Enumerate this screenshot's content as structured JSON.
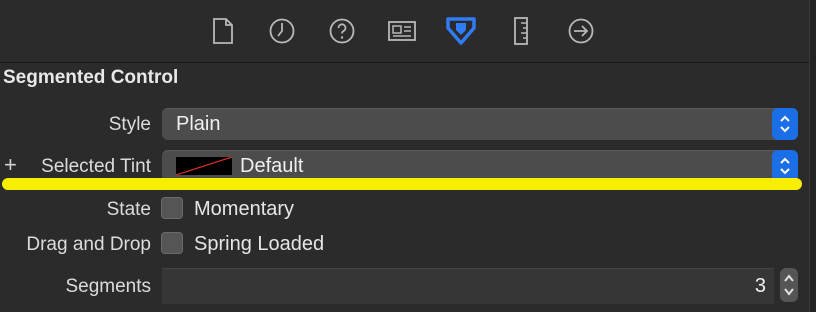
{
  "toolbar": {
    "icons": [
      {
        "name": "file-inspector-icon"
      },
      {
        "name": "history-inspector-icon"
      },
      {
        "name": "quick-help-icon"
      },
      {
        "name": "identity-inspector-icon"
      },
      {
        "name": "attributes-inspector-icon",
        "active": true
      },
      {
        "name": "size-inspector-icon"
      },
      {
        "name": "connections-inspector-icon"
      }
    ],
    "active_color": "#2f7cf6",
    "icon_color": "#b8b8b8"
  },
  "section": {
    "title": "Segmented Control"
  },
  "style": {
    "label": "Style",
    "value": "Plain"
  },
  "tint": {
    "label": "Selected Tint",
    "plus": "+",
    "value": "Default"
  },
  "state": {
    "label": "State",
    "option": "Momentary",
    "checked": false
  },
  "drag_drop": {
    "label": "Drag and Drop",
    "option": "Spring Loaded",
    "checked": false
  },
  "segments": {
    "label": "Segments",
    "value": "3"
  },
  "colors": {
    "highlight": "#f8ef00",
    "accent": "#1b6ee5"
  }
}
